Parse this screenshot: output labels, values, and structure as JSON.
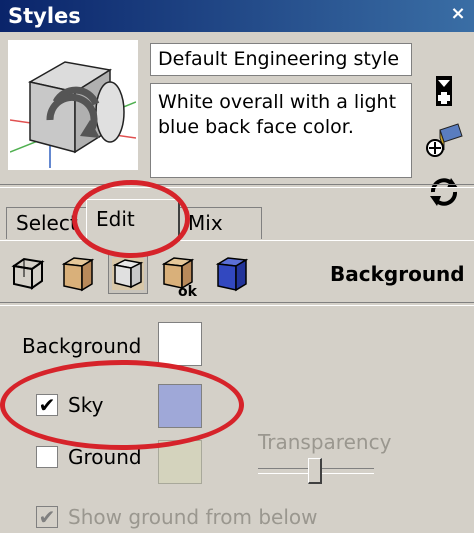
{
  "window": {
    "title": "Styles",
    "close_glyph": "×"
  },
  "style": {
    "name": "Default Engineering style",
    "description": "White overall with a light blue back face color."
  },
  "side_icons": [
    "create-style-icon",
    "update-style-icon",
    "refresh-icon"
  ],
  "tabs": [
    {
      "label": "Select",
      "active": false
    },
    {
      "label": "Edit",
      "active": true
    },
    {
      "label": "Mix",
      "active": false
    }
  ],
  "mode_icons": [
    "edge-settings-icon",
    "face-settings-icon",
    "background-settings-icon",
    "watermark-settings-icon",
    "modeling-settings-icon"
  ],
  "section_label": "Background",
  "background": {
    "background_label": "Background",
    "background_color": "#ffffff",
    "sky_label": "Sky",
    "sky_checked": true,
    "sky_color": "#9fa8d8",
    "ground_label": "Ground",
    "ground_checked": false,
    "ground_color": "#d4d3bd",
    "transparency_label": "Transparency",
    "show_ground_label": "Show ground from below",
    "show_ground_checked": true
  },
  "annotations": {
    "highlight_color": "#d6232a"
  }
}
